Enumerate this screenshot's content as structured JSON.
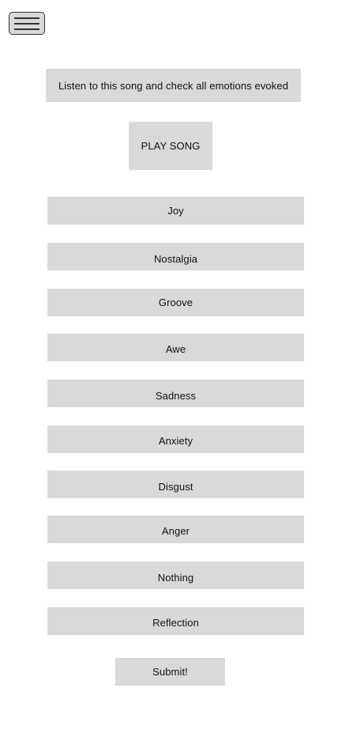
{
  "menu": {
    "icon": "hamburger-menu-icon"
  },
  "instruction": {
    "text": "Listen to this song and check all emotions evoked"
  },
  "player": {
    "play_label": "PLAY SONG"
  },
  "emotions": [
    {
      "label": "Joy"
    },
    {
      "label": "Nostalgia"
    },
    {
      "label": "Groove"
    },
    {
      "label": "Awe"
    },
    {
      "label": "Sadness"
    },
    {
      "label": "Anxiety"
    },
    {
      "label": "Disgust"
    },
    {
      "label": "Anger"
    },
    {
      "label": "Nothing"
    },
    {
      "label": "Reflection"
    }
  ],
  "submit": {
    "label": "Submit!"
  },
  "colors": {
    "box_fill": "#d9d9d9",
    "menu_border": "#333333",
    "text": "#111111",
    "background": "#ffffff"
  }
}
